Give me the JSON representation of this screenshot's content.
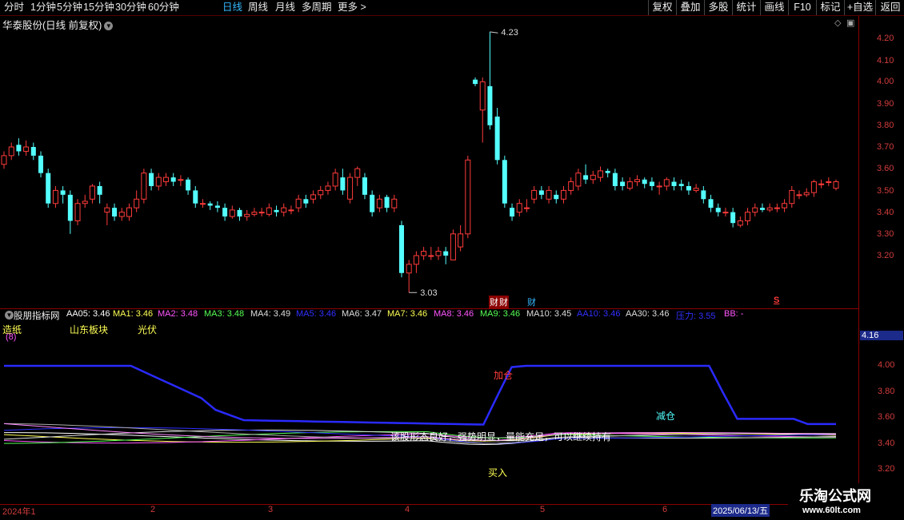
{
  "toolbar": {
    "periods": [
      "分时",
      "1分钟",
      "5分钟",
      "15分钟",
      "30分钟",
      "60分钟",
      "日线",
      "周线",
      "月线",
      "多周期",
      "更多 >"
    ],
    "active": "日线",
    "right": [
      "复权",
      "叠加",
      "多股",
      "统计",
      "画线",
      "F10",
      "标记",
      "+自选",
      "返回"
    ]
  },
  "stock": {
    "title": "华泰股份(日线 前复权)"
  },
  "price_axis": {
    "labels": [
      "4.20",
      "4.10",
      "4.00",
      "3.90",
      "3.80",
      "3.70",
      "3.60",
      "3.50",
      "3.40",
      "3.30",
      "3.20"
    ]
  },
  "annotations": {
    "high": "4.23",
    "low": "3.03",
    "event1": "财",
    "event2": "财",
    "event3": "S"
  },
  "indicator": {
    "name": "股朋指标网",
    "values": [
      {
        "label": "AA05: 3.46",
        "color": "#ffffff"
      },
      {
        "label": "MA1: 3.46",
        "color": "#ffff55"
      },
      {
        "label": "MA2: 3.48",
        "color": "#ff55ff"
      },
      {
        "label": "MA3: 3.48",
        "color": "#55ff55"
      },
      {
        "label": "MA4: 3.49",
        "color": "#dddddd"
      },
      {
        "label": "MA5: 3.46",
        "color": "#3030ff"
      },
      {
        "label": "MA6: 3.47",
        "color": "#dddddd"
      },
      {
        "label": "MA7: 3.46",
        "color": "#ffff55"
      },
      {
        "label": "MA8: 3.46",
        "color": "#ff55ff"
      },
      {
        "label": "MA9: 3.46",
        "color": "#55ff55"
      },
      {
        "label": "MA10: 3.45",
        "color": "#dddddd"
      },
      {
        "label": "AA10: 3.46",
        "color": "#3030ff"
      },
      {
        "label": "AA30: 3.46",
        "color": "#dddddd"
      },
      {
        "label": "压力: 3.55",
        "color": "#3030ff"
      },
      {
        "label": "BB: -",
        "color": "#ff55ff"
      }
    ],
    "tags": {
      "paper": "造纸",
      "count": "(8)",
      "region": "山东板块",
      "pv": "光伏"
    },
    "current": "4.16",
    "axis": [
      "4.00",
      "3.80",
      "3.60",
      "3.40",
      "3.20"
    ],
    "signals": {
      "add": "加仓",
      "reduce": "减仓",
      "buy": "买入",
      "comment": "该股形态良好，强势明显，量能充足，可以继续持有"
    }
  },
  "date_axis": {
    "labels": [
      "2024年1",
      "2",
      "3",
      "4",
      "5",
      "6"
    ],
    "current": "2025/06/13/五"
  },
  "watermark": {
    "title": "乐淘公式网",
    "url": "www.60lt.com"
  },
  "colors": {
    "up": "#ff3b3b",
    "down": "#54ffff",
    "axis": "#d23c3c",
    "grid": "#8b0000",
    "blue": "#2a2aff"
  }
}
